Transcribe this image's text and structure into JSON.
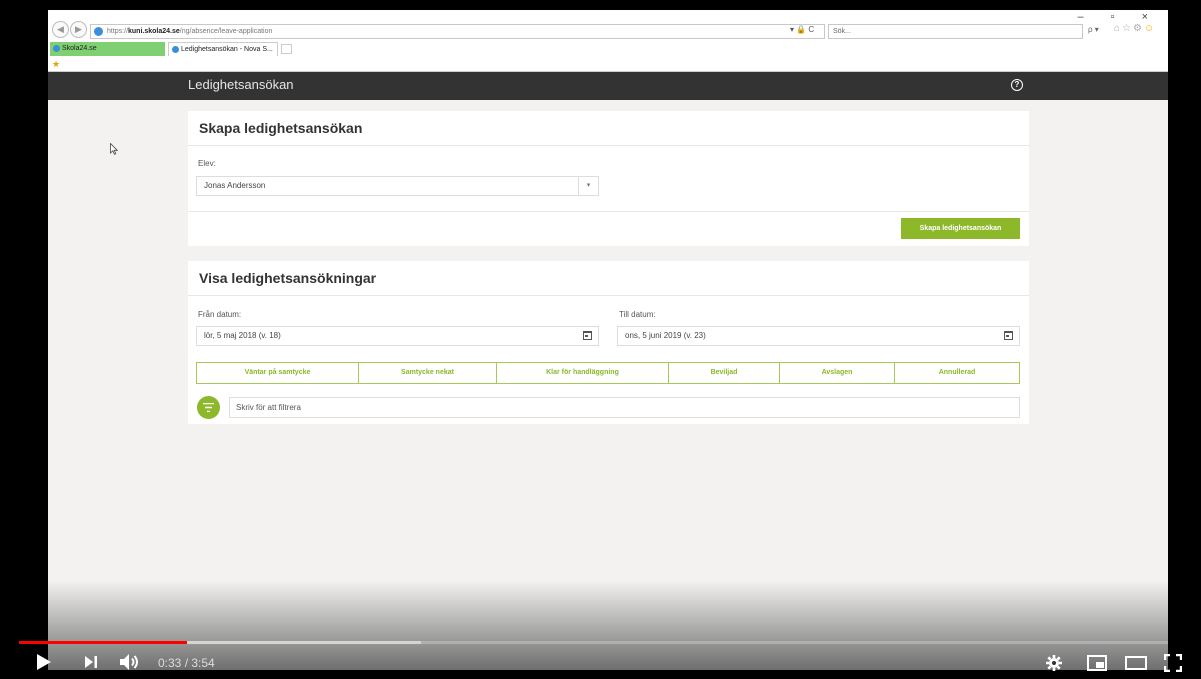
{
  "browser": {
    "url_prefix": "https://",
    "url_host": "kuni.skola24.se",
    "url_path": "/ng/absence/leave-application",
    "address_controls": "▾ 🔒 C",
    "search_placeholder": "Sök...",
    "search_controls": "ρ ▾",
    "window_controls": "– ▫ ×",
    "tabs": [
      {
        "label": "Skola24.se"
      },
      {
        "label": "Ledighetsansökan - Nova S..."
      }
    ],
    "tab_close": "×"
  },
  "app": {
    "title": "Ledighetsansökan",
    "help_glyph": "?"
  },
  "create_card": {
    "title": "Skapa ledighetsansökan",
    "student_label": "Elev:",
    "student_value": "Jonas Andersson",
    "create_button": "Skapa ledighetsansökan"
  },
  "list_card": {
    "title": "Visa ledighetsansökningar",
    "from_label": "Från datum:",
    "from_value": "lör, 5 maj 2018 (v. 18)",
    "to_label": "Till datum:",
    "to_value": "ons, 5 juni 2019 (v. 23)",
    "status_tabs": [
      "Väntar på samtycke",
      "Samtycke nekat",
      "Klar för handläggning",
      "Beviljad",
      "Avslagen",
      "Annullerad"
    ],
    "filter_placeholder": "Skriv för att filtrera"
  },
  "player": {
    "current_time": "0:33",
    "duration": "3:54",
    "played_fraction": 0.146,
    "buffered_fraction": 0.35
  },
  "colors": {
    "accent_green": "#8cb82a",
    "header_dark": "#333333",
    "progress_red": "#ff0000"
  }
}
